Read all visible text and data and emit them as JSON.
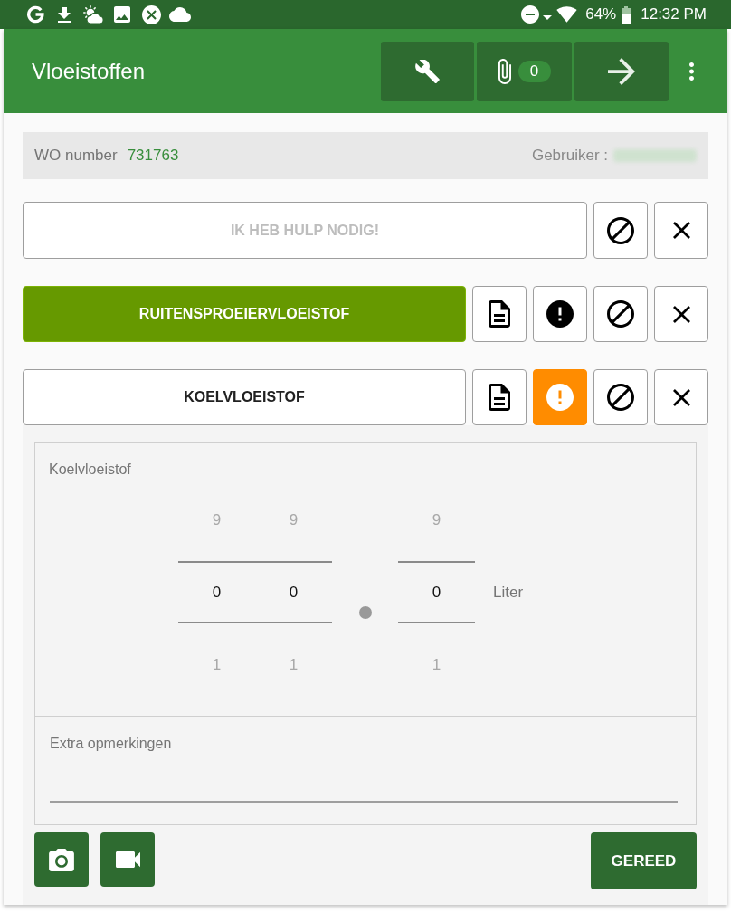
{
  "status_bar": {
    "battery": "64%",
    "time": "12:32 PM"
  },
  "app_bar": {
    "title": "Vloeistoffen",
    "attachment_count": "0"
  },
  "info_bar": {
    "wo_label": "WO number",
    "wo_number": "731763",
    "user_label": "Gebruiker :"
  },
  "help_button": {
    "label": "IK HEB HULP NODIG!",
    "disabled": true
  },
  "fluids": [
    {
      "label": "RUITENSPROEIERVLOEISTOF",
      "completed": true,
      "warning": false,
      "expanded": false
    },
    {
      "label": "KOELVLOEISTOF",
      "completed": false,
      "warning": true,
      "expanded": true,
      "detail": {
        "title": "Koelvloeistof",
        "integer_digits": [
          {
            "above": "9",
            "value": "0",
            "below": "1"
          },
          {
            "above": "9",
            "value": "0",
            "below": "1"
          }
        ],
        "decimal_digits": [
          {
            "above": "9",
            "value": "0",
            "below": "1"
          }
        ],
        "unit": "Liter",
        "remarks": {
          "placeholder": "Extra opmerkingen"
        },
        "done_button": "GEREED"
      }
    }
  ]
}
